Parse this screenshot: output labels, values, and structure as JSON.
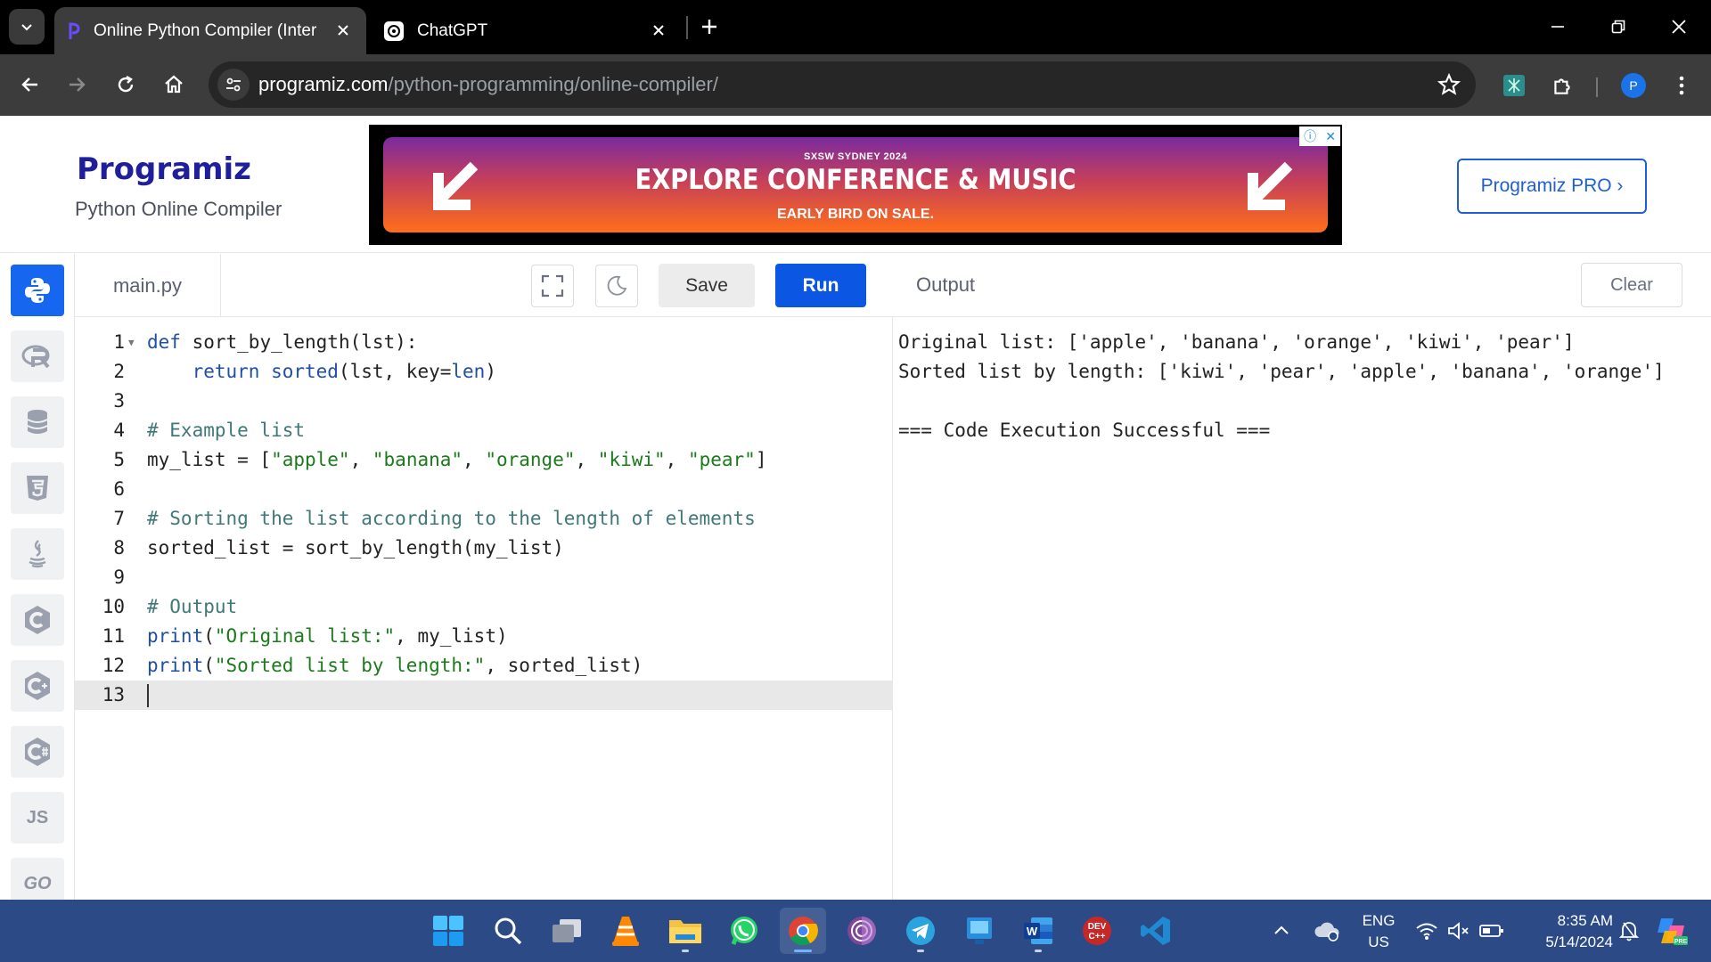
{
  "browser": {
    "tabs": [
      {
        "title": "Online Python Compiler (Interpreter)",
        "active": true
      },
      {
        "title": "ChatGPT",
        "active": false
      }
    ],
    "url_host": "programiz.com",
    "url_path": "/python-programming/online-compiler/",
    "profile_initial": "P"
  },
  "site": {
    "logo": "Programiz",
    "subtitle": "Python Online Compiler",
    "pro_button": "Programiz PRO ›"
  },
  "ad": {
    "small": "SXSW SYDNEY 2024",
    "title": "EXPLORE CONFERENCE & MUSIC",
    "sub": "EARLY BIRD ON SALE."
  },
  "sidebar": {
    "languages": [
      {
        "name": "python-icon",
        "label": ""
      },
      {
        "name": "r-icon",
        "label": ""
      },
      {
        "name": "sql-icon",
        "label": ""
      },
      {
        "name": "html5-icon",
        "label": ""
      },
      {
        "name": "java-icon",
        "label": ""
      },
      {
        "name": "c-icon",
        "label": ""
      },
      {
        "name": "cpp-icon",
        "label": ""
      },
      {
        "name": "csharp-icon",
        "label": ""
      },
      {
        "name": "js-icon",
        "label": "JS"
      },
      {
        "name": "go-icon",
        "label": "GO"
      }
    ]
  },
  "editor": {
    "filename": "main.py",
    "save_label": "Save",
    "run_label": "Run",
    "lines": [
      "def sort_by_length(lst):",
      "    return sorted(lst, key=len)",
      "",
      "# Example list",
      "my_list = [\"apple\", \"banana\", \"orange\", \"kiwi\", \"pear\"]",
      "",
      "# Sorting the list according to the length of elements",
      "sorted_list = sort_by_length(my_list)",
      "",
      "# Output",
      "print(\"Original list:\", my_list)",
      "print(\"Sorted list by length:\", sorted_list)",
      ""
    ]
  },
  "output": {
    "title": "Output",
    "clear_label": "Clear",
    "lines": [
      "Original list: ['apple', 'banana', 'orange', 'kiwi', 'pear']",
      "Sorted list by length: ['kiwi', 'pear', 'apple', 'banana', 'orange']",
      "",
      "=== Code Execution Successful ==="
    ]
  },
  "taskbar": {
    "apps": [
      "windows-start-icon",
      "search-icon",
      "task-view-icon",
      "vlc-icon",
      "file-explorer-icon",
      "whatsapp-icon",
      "chrome-icon",
      "tor-icon",
      "telegram-icon",
      "desktop-app-icon",
      "word-icon",
      "devcpp-icon",
      "vscode-icon"
    ],
    "lang_top": "ENG",
    "lang_bottom": "US",
    "time": "8:35 AM",
    "date": "5/14/2024"
  }
}
